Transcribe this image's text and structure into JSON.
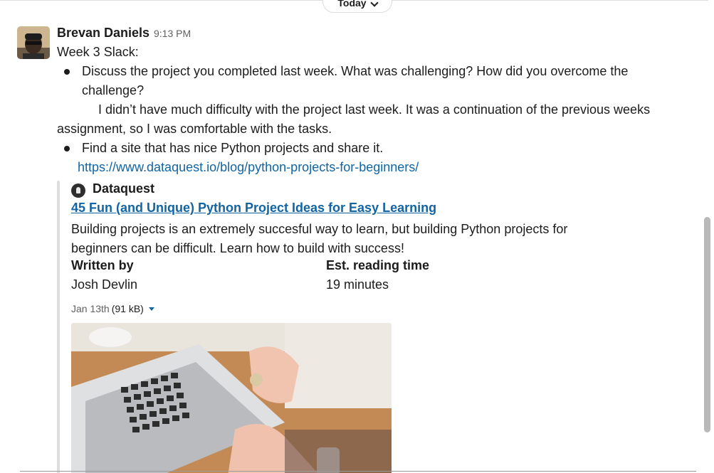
{
  "divider": {
    "label": "Today"
  },
  "message": {
    "author": "Brevan Daniels",
    "time": "9:13 PM",
    "intro": "Week 3 Slack:",
    "bullet1": "Discuss the project you completed last week. What was challenging? How did you overcome the challenge?",
    "answer": "I didn’t have much difficulty with the project last week. It was a continuation of the previous weeks assignment, so I was comfortable with the tasks.",
    "bullet2": "Find a site that has nice Python projects and share it.",
    "link": "https://www.dataquest.io/blog/python-projects-for-beginners/"
  },
  "unfurl": {
    "site_name": "Dataquest",
    "title": "45 Fun (and Unique) Python Project Ideas for Easy Learning",
    "description": "Building projects is an extremely succesful way to learn, but building Python projects for beginners can be difficult. Learn how to build with success!",
    "fields": [
      {
        "label": "Written by",
        "value": "Josh Devlin"
      },
      {
        "label": "Est. reading time",
        "value": "19 minutes"
      }
    ],
    "file_date": "Jan 13th",
    "file_size": "(91 kB)"
  },
  "icons": {
    "avatar": "user-avatar",
    "site": "dataquest-logo-icon",
    "dropdown": "caret-down-icon",
    "divider_chevron": "chevron-down-icon"
  },
  "colors": {
    "link": "#1264a3",
    "text": "#1d1c1d",
    "muted": "#616061"
  }
}
